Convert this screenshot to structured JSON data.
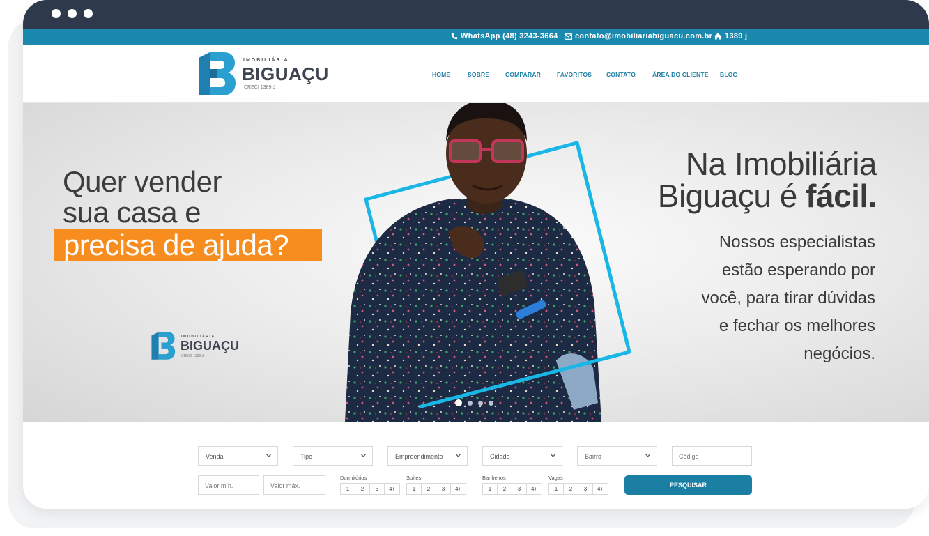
{
  "window": {
    "controls": [
      "window-dot",
      "window-dot",
      "window-dot"
    ]
  },
  "topbar": {
    "whatsapp": "WhatsApp (48) 3243-3664",
    "email": "contato@imobiliariabiguacu.com.br",
    "creci": "1389 j"
  },
  "brand": {
    "small": "IMOBILIÁRIA",
    "name": "BIGUAÇU",
    "creci": "CRECI 1389-J",
    "accent_color": "#1b88ad",
    "dark_color": "#3e4550"
  },
  "nav": {
    "items": [
      {
        "label": "HOME"
      },
      {
        "label": "SOBRE"
      },
      {
        "label": "COMPARAR"
      },
      {
        "label": "FAVORITOS"
      },
      {
        "label": "CONTATO"
      },
      {
        "label": "ÁREA DO CLIENTE"
      },
      {
        "label": "BLOG"
      }
    ]
  },
  "hero": {
    "left_line1": "Quer vender",
    "left_line2": "sua casa e",
    "left_highlight": "precisa de ajuda?",
    "right_title_line1": "Na Imobiliária",
    "right_title_line2_plain": "Biguaçu é ",
    "right_title_line2_bold": "fácil.",
    "right_text": [
      "Nossos especialistas",
      "estão esperando por",
      "você, para tirar dúvidas",
      "e fechar os melhores",
      "negócios."
    ],
    "highlight_color": "#f78d1f",
    "frame_color": "#19b6e6",
    "carousel": {
      "slides": 4,
      "active": 1
    }
  },
  "search": {
    "selects": [
      {
        "value": "Venda"
      },
      {
        "value": "Tipo"
      },
      {
        "value": "Empreendimento"
      },
      {
        "value": "Cidade"
      },
      {
        "value": "Bairro"
      }
    ],
    "codigo_placeholder": "Código",
    "valor_min_placeholder": "Valor mín.",
    "valor_max_placeholder": "Valor máx.",
    "groups": [
      {
        "label": "Dormitórios",
        "options": [
          "1",
          "2",
          "3",
          "4+"
        ]
      },
      {
        "label": "Suítes",
        "options": [
          "1",
          "2",
          "3",
          "4+"
        ]
      },
      {
        "label": "Banheiros",
        "options": [
          "1",
          "2",
          "3",
          "4+"
        ]
      },
      {
        "label": "Vagas",
        "options": [
          "1",
          "2",
          "3",
          "4+"
        ]
      }
    ],
    "button_label": "PESQUISAR"
  }
}
